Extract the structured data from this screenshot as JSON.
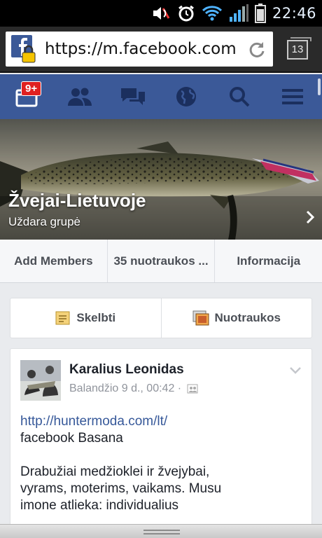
{
  "status_bar": {
    "time": "22:46",
    "icons": [
      "muted-speaker-icon",
      "alarm-icon",
      "wifi-icon",
      "signal-icon",
      "battery-icon"
    ]
  },
  "browser": {
    "url": "https://m.facebook.com",
    "tab_count": "13"
  },
  "nav": {
    "notifications_badge": "9+",
    "items": [
      "notifications-icon",
      "friends-icon",
      "messages-icon",
      "globe-icon",
      "search-icon",
      "menu-icon"
    ],
    "color": "#3b5998"
  },
  "group": {
    "name": "Žvejai-Lietuvoje",
    "type": "Uždara grupė"
  },
  "group_actions": [
    "Add Members",
    "35 nuotraukos ...",
    "Informacija"
  ],
  "composer": {
    "post_label": "Skelbti",
    "photos_label": "Nuotraukos"
  },
  "post": {
    "author": "Karalius Leonidas",
    "timestamp": "Balandžio 9 d., 00:42 ·",
    "link": "http://huntermoda.com/lt/",
    "line2": "facebook Basana",
    "body_lines": [
      "Drabužiai medžioklei ir žvejybai,",
      "vyrams, moterims, vaikams. Musu",
      "imone atlieka: individualius"
    ]
  }
}
